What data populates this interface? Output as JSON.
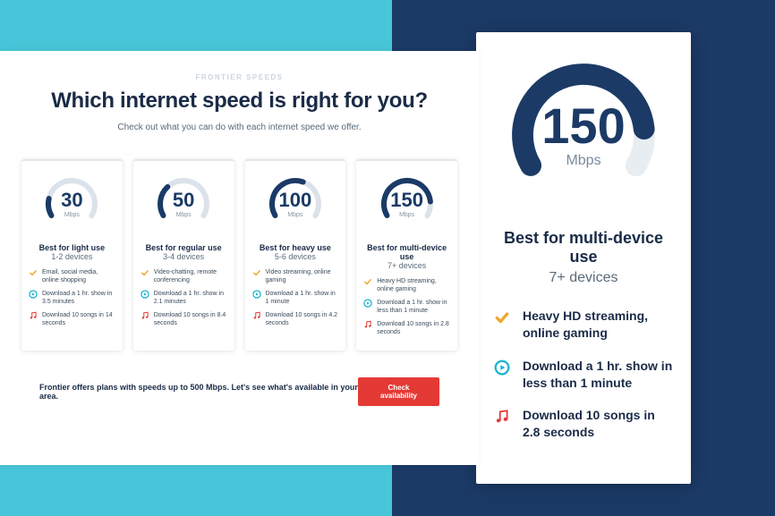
{
  "header": {
    "eyebrow": "FRONTIER SPEEDS",
    "title": "Which internet speed is right for you?",
    "subtitle": "Check out what you can do with each internet speed we offer."
  },
  "plans": [
    {
      "speed": "30",
      "unit": "Mbps",
      "title": "Best for light use",
      "devices": "1-2 devices",
      "fill": 0.18,
      "features": [
        {
          "icon": "check",
          "text": "Email, social media, online shopping"
        },
        {
          "icon": "play",
          "text": "Download a 1 hr. show in 3.5 minutes"
        },
        {
          "icon": "music",
          "text": "Download 10 songs in 14 seconds"
        }
      ]
    },
    {
      "speed": "50",
      "unit": "Mbps",
      "title": "Best for regular use",
      "devices": "3-4 devices",
      "fill": 0.32,
      "features": [
        {
          "icon": "check",
          "text": "Video-chatting, remote conferencing"
        },
        {
          "icon": "play",
          "text": "Download a 1 hr. show in 2.1 minutes"
        },
        {
          "icon": "music",
          "text": "Download 10 songs in 8.4 seconds"
        }
      ]
    },
    {
      "speed": "100",
      "unit": "Mbps",
      "title": "Best for heavy use",
      "devices": "5-6 devices",
      "fill": 0.58,
      "features": [
        {
          "icon": "check",
          "text": "Video streaming, online gaming"
        },
        {
          "icon": "play",
          "text": "Download a 1 hr. show in 1 minute"
        },
        {
          "icon": "music",
          "text": "Download 10 songs in 4.2 seconds"
        }
      ]
    },
    {
      "speed": "150",
      "unit": "Mbps",
      "title": "Best for multi-device use",
      "devices": "7+ devices",
      "fill": 0.85,
      "features": [
        {
          "icon": "check",
          "text": "Heavy HD streaming, online gaming"
        },
        {
          "icon": "play",
          "text": "Download a 1 hr. show in less than 1 minute"
        },
        {
          "icon": "music",
          "text": "Download 10 songs in 2.8 seconds"
        }
      ]
    }
  ],
  "footer": {
    "text": "Frontier offers plans with speeds up to 500 Mbps. Let's see what's available in your area.",
    "cta": "Check availability"
  },
  "detail": {
    "speed": "150",
    "unit": "Mbps",
    "title": "Best for multi-device use",
    "devices": "7+ devices",
    "fill": 0.85,
    "features": [
      {
        "icon": "check",
        "text": "Heavy HD streaming, online gaming"
      },
      {
        "icon": "play",
        "text": "Download a 1 hr. show in less than 1 minute"
      },
      {
        "icon": "music",
        "text": "Download 10 songs in 2.8 seconds"
      }
    ]
  },
  "gauge": {
    "circumference": 163.36,
    "arc_fraction": 0.667
  }
}
